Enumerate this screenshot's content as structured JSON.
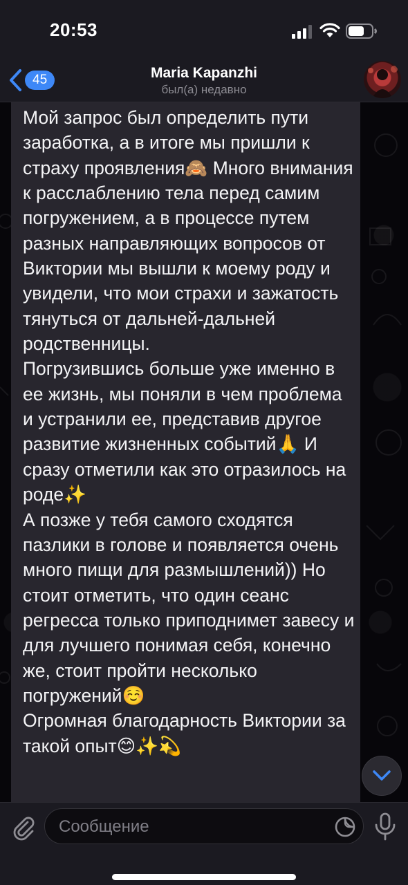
{
  "status_bar": {
    "time": "20:53"
  },
  "header": {
    "back_badge": "45",
    "title": "Maria Kapanzhi",
    "subtitle": "был(а) недавно"
  },
  "message": {
    "text": "Мой запрос был определить пути заработка, а в итоге мы пришли к страху проявления🙈 Много внимания к расслаблению тела перед самим погружением, а в процессе путем разных направляющих вопросов от Виктории мы вышли к моему роду и увидели, что мои страхи и зажатость тянуться от дальней-дальней родственницы.\nПогрузившись больше уже именно в ее жизнь, мы поняли в чем проблема и устранили ее, представив другое развитие жизненных событий🙏 И сразу отметили как это отразилось на роде✨\nА позже у тебя самого сходятся пазлики в голове и появляется очень много пищи для размышлений)) Но стоит отметить, что один сеанс регресса только приподнимет завесу и для лучшего понимая себя, конечно же, стоит пройти несколько погружений☺️\nОгромная благодарность Виктории за такой опыт😊✨💫"
  },
  "input": {
    "placeholder": "Сообщение"
  },
  "icons": {
    "back": "chevron-left-icon",
    "signal": "cellular-signal-icon",
    "wifi": "wifi-icon",
    "battery": "battery-icon",
    "attach": "paperclip-icon",
    "sticker": "sticker-icon",
    "mic": "microphone-icon",
    "scroll_down": "chevron-down-icon"
  },
  "colors": {
    "accent": "#3e88f7",
    "bubble": "#28262e",
    "bar": "#1b1a21"
  }
}
